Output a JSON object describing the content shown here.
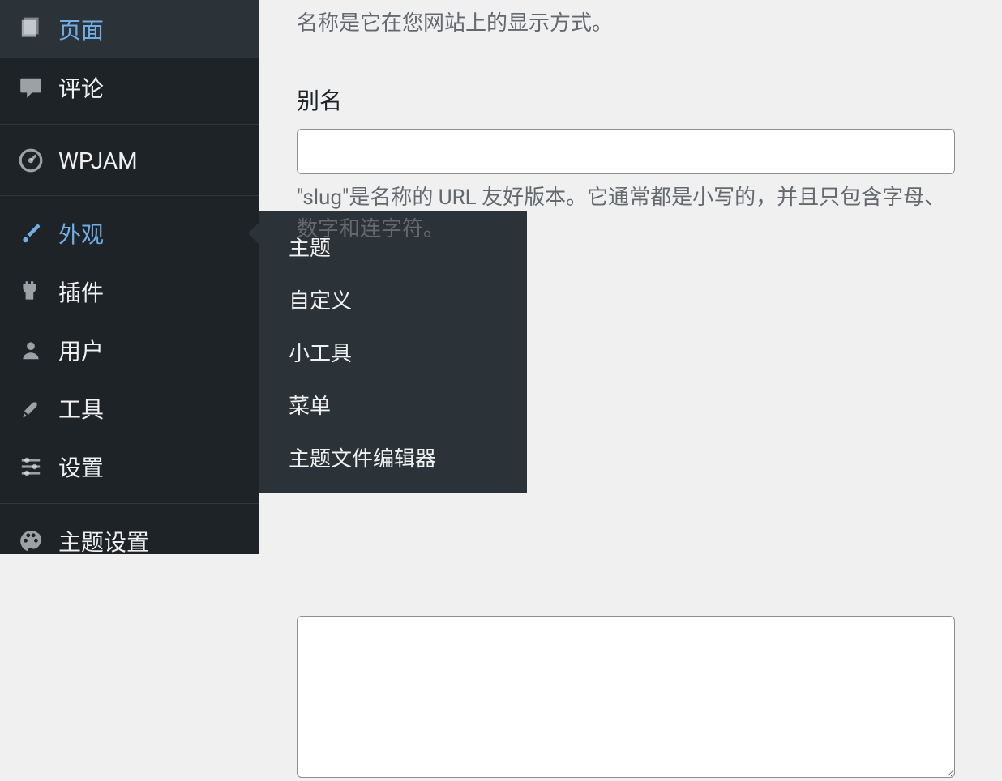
{
  "sidebar": {
    "items": [
      {
        "label": "页面",
        "icon": "pages"
      },
      {
        "label": "评论",
        "icon": "comments"
      },
      {
        "label": "WPJAM",
        "icon": "dashboard"
      },
      {
        "label": "外观",
        "icon": "appearance"
      },
      {
        "label": "插件",
        "icon": "plugins"
      },
      {
        "label": "用户",
        "icon": "users"
      },
      {
        "label": "工具",
        "icon": "tools"
      },
      {
        "label": "设置",
        "icon": "settings"
      },
      {
        "label": "主题设置",
        "icon": "theme-settings"
      }
    ]
  },
  "submenu": {
    "items": [
      {
        "label": "主题"
      },
      {
        "label": "自定义"
      },
      {
        "label": "小工具"
      },
      {
        "label": "菜单"
      },
      {
        "label": "主题文件编辑器"
      }
    ]
  },
  "form": {
    "name_description": "名称是它在您网站上的显示方式。",
    "slug_label": "别名",
    "slug_value": "",
    "slug_description": "\"slug\"是名称的 URL 友好版本。它通常都是小写的，并且只包含字母、数字和连字符。",
    "description_value": ""
  }
}
